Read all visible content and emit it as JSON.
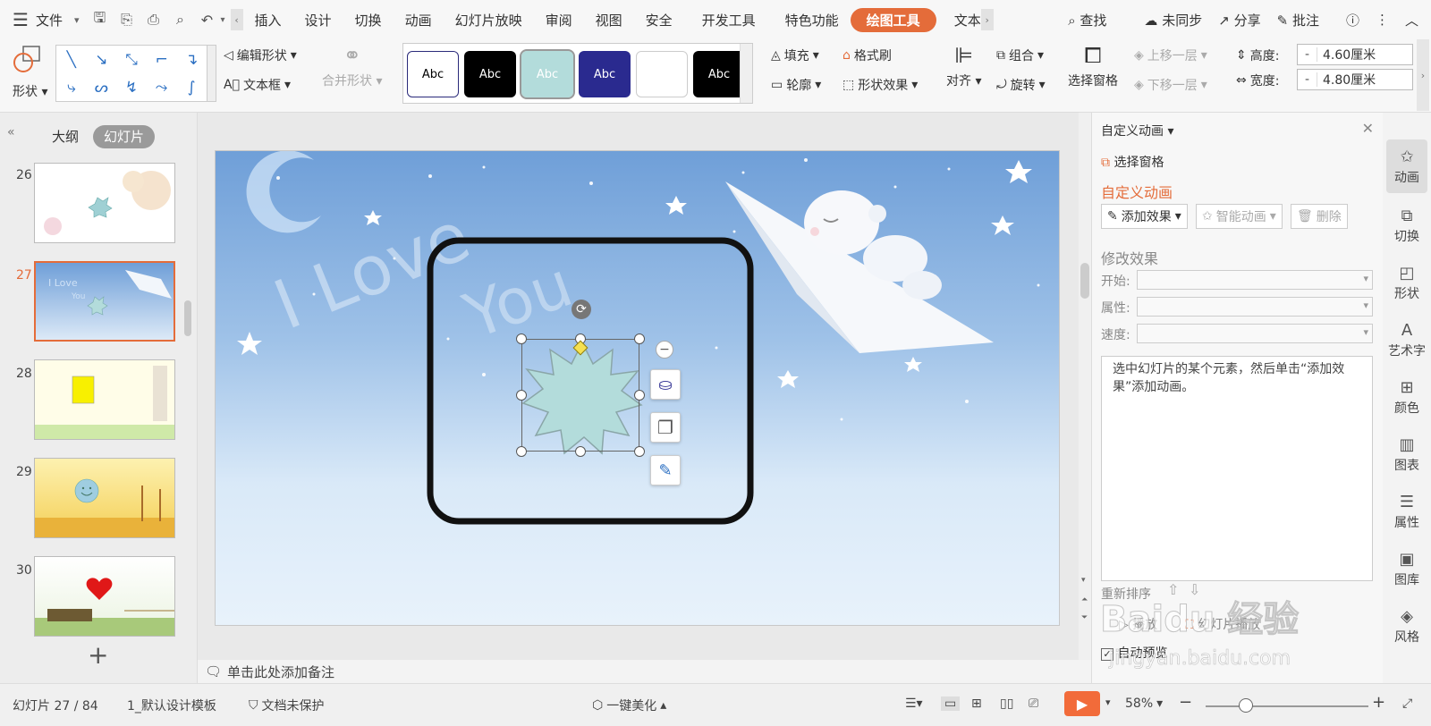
{
  "menubar": {
    "file": "文件",
    "tabs": [
      "插入",
      "设计",
      "切换",
      "动画",
      "幻灯片放映",
      "审阅",
      "视图",
      "安全",
      "开发工具",
      "特色功能"
    ],
    "active_tab": "绘图工具",
    "next_tab": "文本",
    "search": "查找",
    "sync": "未同步",
    "share": "分享",
    "review": "批注"
  },
  "ribbon": {
    "shape": "形状",
    "edit_shape": "编辑形状",
    "text_box": "文本框",
    "merge_shape": "合并形状",
    "style_sample": "Abc",
    "fill": "填充",
    "format_painter": "格式刷",
    "outline": "轮廓",
    "shape_effect": "形状效果",
    "align": "对齐",
    "group": "组合",
    "rotate": "旋转",
    "selection_pane": "选择窗格",
    "bring_forward": "上移一层",
    "send_backward": "下移一层",
    "height_label": "高度:",
    "height_value": "4.60厘米",
    "width_label": "宽度:",
    "width_value": "4.80厘米",
    "minus": "-"
  },
  "leftpanel": {
    "tab_outline": "大纲",
    "tab_slides": "幻灯片",
    "slides": [
      {
        "num": "26"
      },
      {
        "num": "27"
      },
      {
        "num": "28"
      },
      {
        "num": "29"
      },
      {
        "num": "30"
      }
    ],
    "current_slide": "27"
  },
  "notes": {
    "placeholder": "单击此处添加备注"
  },
  "taskpane": {
    "title": "自定义动画",
    "selection_pane": "选择窗格",
    "section_title": "自定义动画",
    "add_effect": "添加效果",
    "smart_anim": "智能动画",
    "delete": "删除",
    "modify_effect": "修改效果",
    "start_label": "开始:",
    "property_label": "属性:",
    "speed_label": "速度:",
    "hint": "选中幻灯片的某个元素，然后单击“添加效果”添加动画。",
    "reorder": "重新排序",
    "play": "播放",
    "slideshow": "幻灯片播放",
    "auto_preview": "自动预览"
  },
  "rightbar": {
    "items": [
      "动画",
      "切换",
      "形状",
      "艺术字",
      "颜色",
      "图表",
      "属性",
      "图库",
      "风格"
    ]
  },
  "statusbar": {
    "slide_info": "幻灯片 27 / 84",
    "template": "1_默认设计模板",
    "protect": "文档未保护",
    "beautify": "一键美化",
    "zoom": "58%"
  },
  "slide": {
    "text_art_1": "I Love",
    "text_art_2": "You"
  },
  "watermark": {
    "brand": "Baidu 经验",
    "url": "jingyan.baidu.com"
  },
  "colors": {
    "accent": "#e46c3a",
    "star_fill": "#b3dcdb",
    "sky_top": "#6f9fd8",
    "sky_bottom": "#e8f2fb"
  }
}
